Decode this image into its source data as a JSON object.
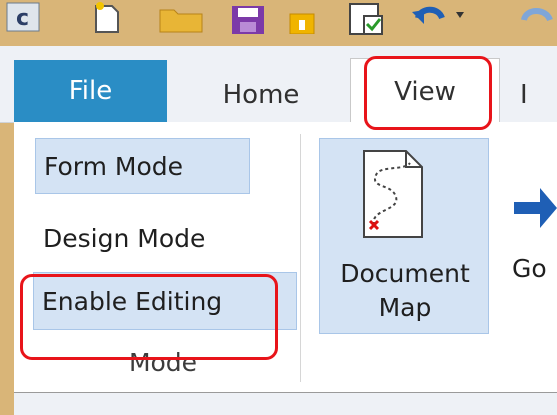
{
  "tabs": [
    {
      "label": "File",
      "active": false
    },
    {
      "label": "Home",
      "active": false
    },
    {
      "label": "View",
      "active": true
    },
    {
      "label": "I",
      "active": false
    }
  ],
  "mode_group": {
    "buttons": [
      {
        "label": "Form Mode",
        "selected": true
      },
      {
        "label": "Design Mode",
        "selected": false
      },
      {
        "label": "Enable Editing",
        "selected": true
      }
    ],
    "group_label": "Mode"
  },
  "document_map": {
    "label_line1": "Document",
    "label_line2": "Map",
    "selected": true
  },
  "go_button": {
    "label": "Go"
  },
  "colors": {
    "file_tab": "#2a8dc5",
    "selection": "#d4e3f4",
    "highlight": "#e8141a",
    "toolbar_bg": "#d9b578"
  },
  "icons": [
    "c-icon",
    "new-document-icon",
    "open-folder-icon",
    "save-icon",
    "lock-icon",
    "form-check-icon",
    "undo-icon",
    "document-map-icon",
    "arrow-right-icon"
  ]
}
